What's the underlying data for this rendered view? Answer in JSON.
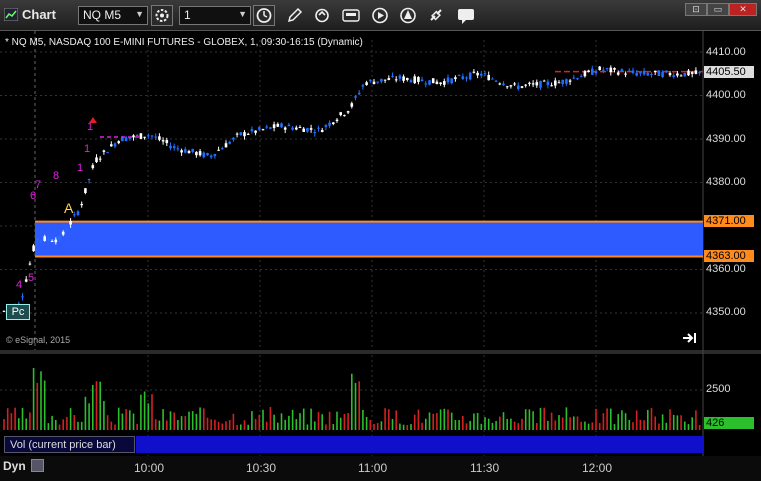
{
  "window": {
    "title": "Chart",
    "symbol": "NQ M5",
    "interval": "1"
  },
  "legend": "* NQ M5, NASDAQ 100 E-MINI FUTURES - GLOBEX, 1, 09:30-16:15 (Dynamic)",
  "watermark": "© eSignal, 2015",
  "price_axis": {
    "ticks": [
      "4410.00",
      "4400.00",
      "4390.00",
      "4380.00",
      "4360.00",
      "4350.00"
    ],
    "current_price": "4405.50",
    "upper_level": "4371.00",
    "lower_level": "4363.00"
  },
  "volume_axis": {
    "tick": "2500",
    "current": "426"
  },
  "volume_panel_label": "Vol (current price bar)",
  "time_axis": [
    "10:00",
    "10:30",
    "11:00",
    "11:30",
    "12:00"
  ],
  "status": {
    "mode": "Dyn"
  },
  "chart_annotations": {
    "pc_label": "Pc",
    "a_label": "A",
    "counts": [
      "4",
      "5",
      "6",
      "7",
      "8",
      "1",
      "1",
      "1"
    ]
  },
  "colors": {
    "up_bar": "#ffffff",
    "down_bar": "#1f6fff",
    "range_fill": "#2e5bff",
    "range_edge": "#ff8a1e",
    "current_price_line": "#d22",
    "tag_orange": "#ff8a1e",
    "volume_up": "#2bbf2b",
    "volume_down": "#d42020"
  },
  "chart_data": {
    "type": "candlestick",
    "ylim": [
      4342,
      4413
    ],
    "range_band": [
      4363.0,
      4371.0
    ],
    "current_price": 4405.5
  }
}
